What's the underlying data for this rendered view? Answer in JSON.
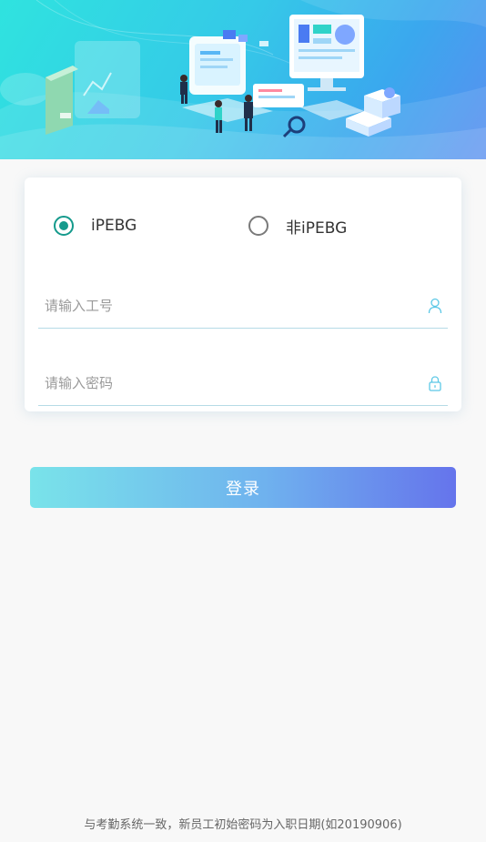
{
  "login_type": {
    "options": [
      {
        "label": "iPEBG",
        "selected": true
      },
      {
        "label": "非iPEBG",
        "selected": false
      }
    ]
  },
  "form": {
    "employee_id": {
      "placeholder": "请输入工号",
      "value": "",
      "icon": "user-icon"
    },
    "password": {
      "placeholder": "请输入密码",
      "value": "",
      "icon": "lock-icon"
    }
  },
  "login_button": {
    "label": "登录"
  },
  "footer_note": "与考勤系统一致，新员工初始密码为入职日期(如20190906)",
  "colors": {
    "accent": "#159a8c",
    "button_gradient_start": "#79e3ea",
    "button_gradient_end": "#6574ec",
    "field_border": "#b6dbe6"
  }
}
